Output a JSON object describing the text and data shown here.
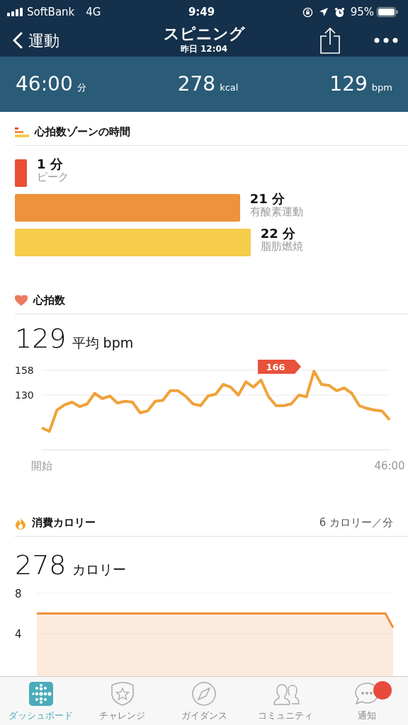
{
  "status_bar": {
    "carrier": "SoftBank",
    "network": "4G",
    "time": "9:49",
    "battery": "95%"
  },
  "nav": {
    "back": "運動",
    "title": "スピニング",
    "subtitle": "昨日 12:04"
  },
  "summary": [
    {
      "value": "46:00",
      "unit": "分"
    },
    {
      "value": "278",
      "unit": "kcal"
    },
    {
      "value": "129",
      "unit": "bpm"
    }
  ],
  "zones": {
    "title": "心拍数ゾーンの時間",
    "items": [
      {
        "value": "1 分",
        "label": "ピーク",
        "color": "#e94f35"
      },
      {
        "value": "21 分",
        "label": "有酸素運動",
        "color": "#ee923c"
      },
      {
        "value": "22 分",
        "label": "脂肪燃焼",
        "color": "#f6cc4b"
      }
    ]
  },
  "heart_rate": {
    "title": "心拍数",
    "value": "129",
    "unit": "平均 bpm",
    "peak_label": "166",
    "chart_data": {
      "type": "line",
      "categories": [
        "開始",
        null,
        null,
        null,
        null,
        null,
        null,
        null,
        null,
        null,
        null,
        null,
        null,
        null,
        null,
        null,
        null,
        null,
        null,
        null,
        null,
        null,
        null,
        null,
        null,
        null,
        null,
        null,
        null,
        null,
        null,
        null,
        null,
        null,
        null,
        null,
        null,
        null,
        null,
        null,
        null,
        null,
        null,
        null,
        null,
        null,
        "46:00"
      ],
      "series": [
        {
          "color": "#f0a23a",
          "values": [
            93,
            89,
            113,
            119,
            122,
            117,
            120,
            132,
            126,
            129,
            121,
            123,
            122,
            110,
            112,
            123,
            124,
            135,
            135,
            129,
            120,
            118,
            129,
            131,
            142,
            139,
            130,
            145,
            139,
            147,
            128,
            118,
            118,
            120,
            130,
            128,
            157,
            142,
            141,
            135,
            138,
            132,
            118,
            115,
            113,
            112,
            102
          ]
        }
      ],
      "ylim": [
        68,
        158
      ],
      "yticks": [
        130,
        158
      ]
    }
  },
  "calories": {
    "title": "消費カロリー",
    "rate": "6 カロリー／分",
    "value": "278",
    "unit": "カロリー",
    "chart_data": {
      "type": "area",
      "categories": [
        null,
        null,
        null,
        null,
        null,
        null,
        null,
        null,
        null,
        null,
        null,
        null,
        null,
        null,
        null,
        null,
        null,
        null,
        null,
        null,
        null,
        null,
        null,
        null,
        null,
        null,
        null,
        null,
        null,
        null,
        null,
        null,
        null,
        null,
        null,
        null,
        null,
        null,
        null,
        null,
        null,
        null,
        null,
        null,
        null,
        null,
        null
      ],
      "series": [
        {
          "color": "#ee923c",
          "values": [
            6,
            6,
            6,
            6,
            6,
            6,
            6,
            6,
            6,
            6,
            6,
            6,
            6,
            6,
            6,
            6,
            6,
            6,
            6,
            6,
            6,
            6,
            6,
            6,
            6,
            6,
            6,
            6,
            6,
            6,
            6,
            6,
            6,
            6,
            6,
            6,
            6,
            6,
            6,
            6,
            6,
            6,
            6,
            6,
            6,
            6,
            4.6
          ]
        }
      ],
      "ylim": [
        0,
        8
      ],
      "yticks": [
        4,
        8
      ]
    }
  },
  "tabs": [
    {
      "label": "ダッシュボード",
      "kind": "dashboard",
      "selected": true,
      "badge": false
    },
    {
      "label": "チャレンジ",
      "kind": "challenge",
      "selected": false,
      "badge": false
    },
    {
      "label": "ガイダンス",
      "kind": "compass",
      "selected": false,
      "badge": false
    },
    {
      "label": "コミュニティ",
      "kind": "people",
      "selected": false,
      "badge": false
    },
    {
      "label": "通知",
      "kind": "chat",
      "selected": false,
      "badge": true
    }
  ]
}
